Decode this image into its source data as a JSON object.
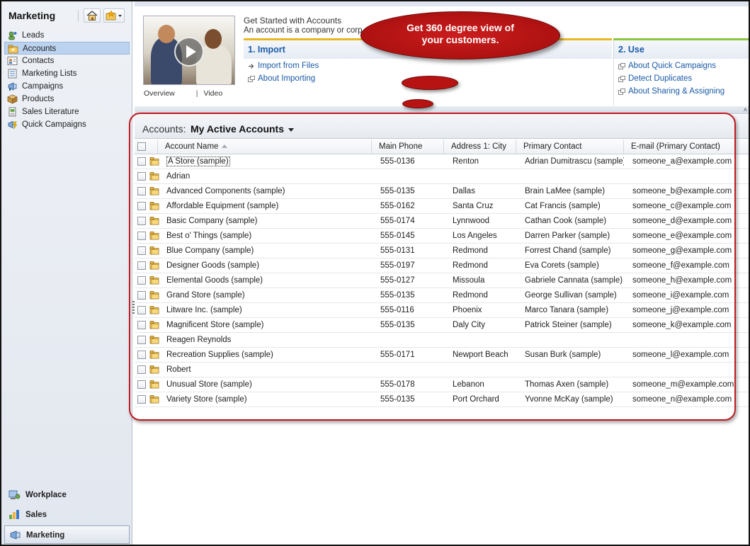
{
  "nav": {
    "title": "Marketing",
    "items": [
      {
        "label": "Leads",
        "icon": "leads-icon",
        "selected": false
      },
      {
        "label": "Accounts",
        "icon": "accounts-icon",
        "selected": true
      },
      {
        "label": "Contacts",
        "icon": "contacts-icon",
        "selected": false
      },
      {
        "label": "Marketing Lists",
        "icon": "marketing-lists-icon",
        "selected": false
      },
      {
        "label": "Campaigns",
        "icon": "campaigns-icon",
        "selected": false
      },
      {
        "label": "Products",
        "icon": "products-icon",
        "selected": false
      },
      {
        "label": "Sales Literature",
        "icon": "sales-literature-icon",
        "selected": false
      },
      {
        "label": "Quick Campaigns",
        "icon": "quick-campaigns-icon",
        "selected": false
      }
    ],
    "workspaces": [
      {
        "label": "Workplace",
        "selected": false
      },
      {
        "label": "Sales",
        "selected": false
      },
      {
        "label": "Marketing",
        "selected": true
      }
    ]
  },
  "get_started": {
    "title": "Get Started with Accounts",
    "description": "An account is a company or corp",
    "video_links": {
      "overview": "Overview",
      "separator": "|",
      "video": "Video"
    },
    "import": {
      "heading": "1. Import",
      "links": [
        "Import from Files",
        "About Importing"
      ]
    },
    "use": {
      "heading": "2. Use",
      "links": [
        "About Quick Campaigns",
        "Detect Duplicates",
        "About Sharing & Assigning"
      ]
    }
  },
  "callout": {
    "line1": "Get 360 degree view of",
    "line2": "your customers."
  },
  "grid": {
    "entity_label": "Accounts:",
    "view_name": "My Active Accounts",
    "columns": [
      "Account Name",
      "Main Phone",
      "Address 1: City",
      "Primary Contact",
      "E-mail (Primary Contact)"
    ],
    "rows": [
      [
        "A Store (sample)",
        "555-0136",
        "Renton",
        "Adrian Dumitrascu (sample)",
        "someone_a@example.com"
      ],
      [
        "Adrian",
        "",
        "",
        "",
        ""
      ],
      [
        "Advanced Components (sample)",
        "555-0135",
        "Dallas",
        "Brain LaMee (sample)",
        "someone_b@example.com"
      ],
      [
        "Affordable Equipment (sample)",
        "555-0162",
        "Santa Cruz",
        "Cat Francis (sample)",
        "someone_c@example.com"
      ],
      [
        "Basic Company (sample)",
        "555-0174",
        "Lynnwood",
        "Cathan Cook (sample)",
        "someone_d@example.com"
      ],
      [
        "Best o' Things (sample)",
        "555-0145",
        "Los Angeles",
        "Darren Parker (sample)",
        "someone_e@example.com"
      ],
      [
        "Blue Company (sample)",
        "555-0131",
        "Redmond",
        "Forrest Chand (sample)",
        "someone_g@example.com"
      ],
      [
        "Designer Goods (sample)",
        "555-0197",
        "Redmond",
        "Eva Corets (sample)",
        "someone_f@example.com"
      ],
      [
        "Elemental Goods (sample)",
        "555-0127",
        "Missoula",
        "Gabriele Cannata (sample)",
        "someone_h@example.com"
      ],
      [
        "Grand Store (sample)",
        "555-0135",
        "Redmond",
        "George Sullivan (sample)",
        "someone_i@example.com"
      ],
      [
        "Litware Inc. (sample)",
        "555-0116",
        "Phoenix",
        "Marco Tanara (sample)",
        "someone_j@example.com"
      ],
      [
        "Magnificent Store (sample)",
        "555-0135",
        "Daly City",
        "Patrick Steiner (sample)",
        "someone_k@example.com"
      ],
      [
        "Reagen Reynolds",
        "",
        "",
        "",
        ""
      ],
      [
        "Recreation Supplies (sample)",
        "555-0171",
        "Newport Beach",
        "Susan Burk (sample)",
        "someone_l@example.com"
      ],
      [
        "Robert",
        "",
        "",
        "",
        ""
      ],
      [
        "Unusual Store (sample)",
        "555-0178",
        "Lebanon",
        "Thomas Axen (sample)",
        "someone_m@example.com"
      ],
      [
        "Variety Store (sample)",
        "555-0135",
        "Port Orchard",
        "Yvonne McKay (sample)",
        "someone_n@example.com"
      ]
    ]
  },
  "colors": {
    "accent": "#1a5aa6",
    "import_bar": "#e8b824",
    "use_bar": "#8cc63e",
    "annotation": "#c01a20",
    "selected": "#bcd3ef"
  }
}
